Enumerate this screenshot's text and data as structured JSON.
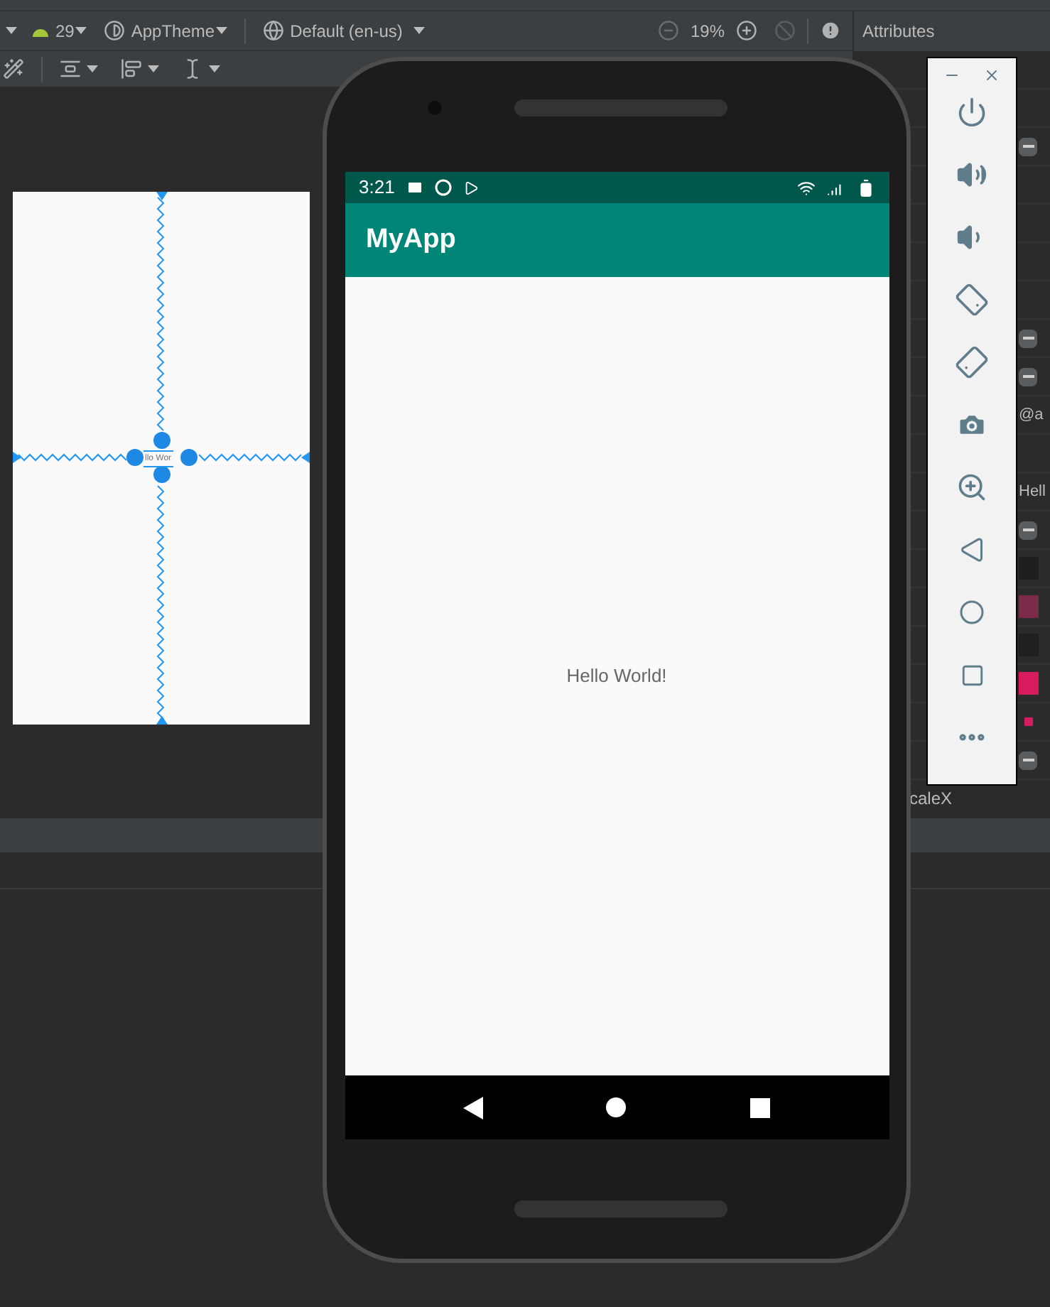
{
  "toolbar": {
    "api_level": "29",
    "theme": "AppTheme",
    "locale": "Default (en-us)",
    "zoom": "19%"
  },
  "attributes": {
    "title": "Attributes",
    "rows": [
      {
        "kind": "text"
      },
      {
        "kind": "text"
      },
      {
        "kind": "minus"
      },
      {
        "kind": "text"
      },
      {
        "kind": "text"
      },
      {
        "kind": "text"
      },
      {
        "kind": "text"
      },
      {
        "kind": "minus"
      },
      {
        "kind": "minus"
      },
      {
        "kind": "text",
        "value": "@a"
      },
      {
        "kind": "text"
      },
      {
        "kind": "text",
        "value": "Hell"
      },
      {
        "kind": "minus"
      },
      {
        "kind": "swatch",
        "color": "#1f1f1f"
      },
      {
        "kind": "swatch",
        "color": "#7b2a4a"
      },
      {
        "kind": "swatch",
        "color": "#202020"
      },
      {
        "kind": "swatch",
        "color": "#d81b60"
      },
      {
        "kind": "dot",
        "color": "#d81b60"
      },
      {
        "kind": "minus"
      },
      {
        "kind": "text",
        "label": "caleX"
      }
    ]
  },
  "blueprint": {
    "text": "llo Wor"
  },
  "device": {
    "time": "3:21",
    "app_title": "MyApp",
    "content": "Hello World!"
  },
  "emulator_controls": [
    {
      "kind": "power"
    },
    {
      "kind": "volume-up"
    },
    {
      "kind": "volume-down"
    },
    {
      "kind": "rotate-left"
    },
    {
      "kind": "rotate-right"
    },
    {
      "kind": "camera"
    },
    {
      "kind": "zoom"
    },
    {
      "kind": "back"
    },
    {
      "kind": "home"
    },
    {
      "kind": "overview"
    },
    {
      "kind": "more"
    }
  ]
}
